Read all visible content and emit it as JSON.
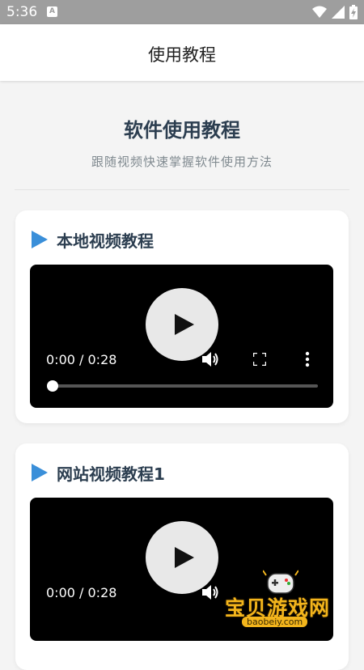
{
  "status_bar": {
    "time": "5:36",
    "notification_letter": "A"
  },
  "app_bar": {
    "title": "使用教程"
  },
  "hero": {
    "title": "软件使用教程",
    "subtitle": "跟随视频快速掌握软件使用方法"
  },
  "sections": [
    {
      "title": "本地视频教程",
      "video": {
        "time": "0:00 / 0:28",
        "progress": 0
      }
    },
    {
      "title": "网站视频教程1",
      "video": {
        "time": "0:00 / 0:28",
        "progress": 0
      }
    }
  ],
  "watermark": {
    "text": "宝贝游戏网",
    "url": "baobeiy.com"
  },
  "colors": {
    "accent": "#3a8fd9",
    "heading": "#2c3e50",
    "statusbar": "#9e9e9e",
    "watermark": "#f3b51c"
  }
}
